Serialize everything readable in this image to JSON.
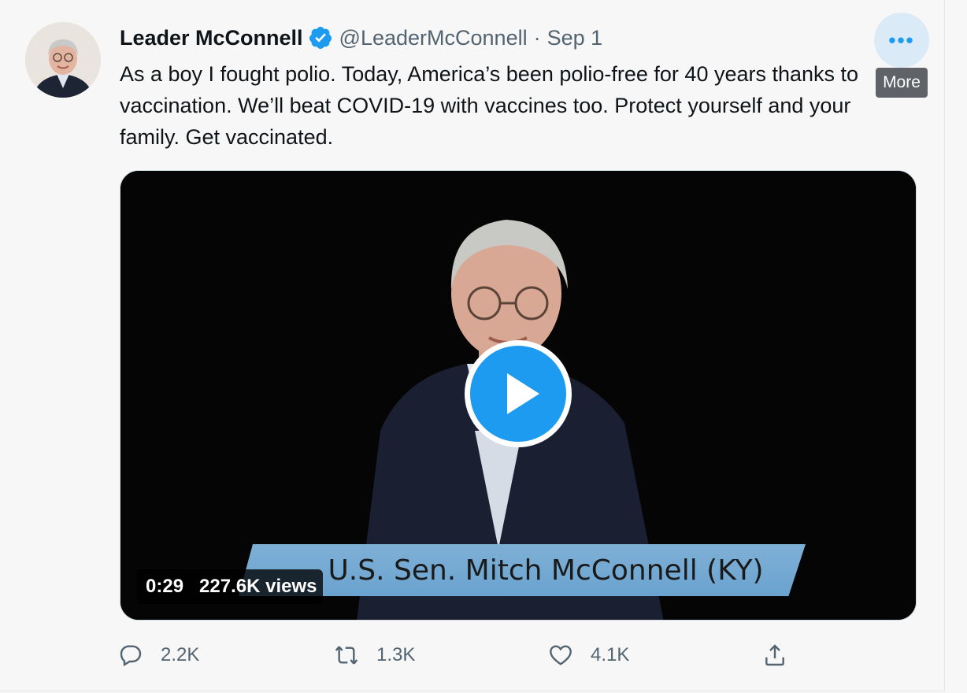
{
  "author": {
    "name": "Leader McConnell",
    "handle": "@LeaderMcConnell",
    "separator": "·",
    "date": "Sep 1"
  },
  "tweet": {
    "text": "As a boy I fought polio. Today, America’s been polio-free for 40 years thanks to vaccination. We’ll beat COVID-19 with vaccines too. Protect yourself and your family. Get vaccinated."
  },
  "more": {
    "icon": "more-icon",
    "label": "•••",
    "tooltip": "More"
  },
  "video": {
    "caption": "U.S. Sen. Mitch McConnell (KY)",
    "duration": "0:29",
    "views": "227.6K views"
  },
  "actions": {
    "reply_count": "2.2K",
    "retweet_count": "1.3K",
    "like_count": "4.1K"
  },
  "colors": {
    "accent": "#1d9bf0",
    "text_secondary": "#536471",
    "verified": "#1d9bf0"
  }
}
